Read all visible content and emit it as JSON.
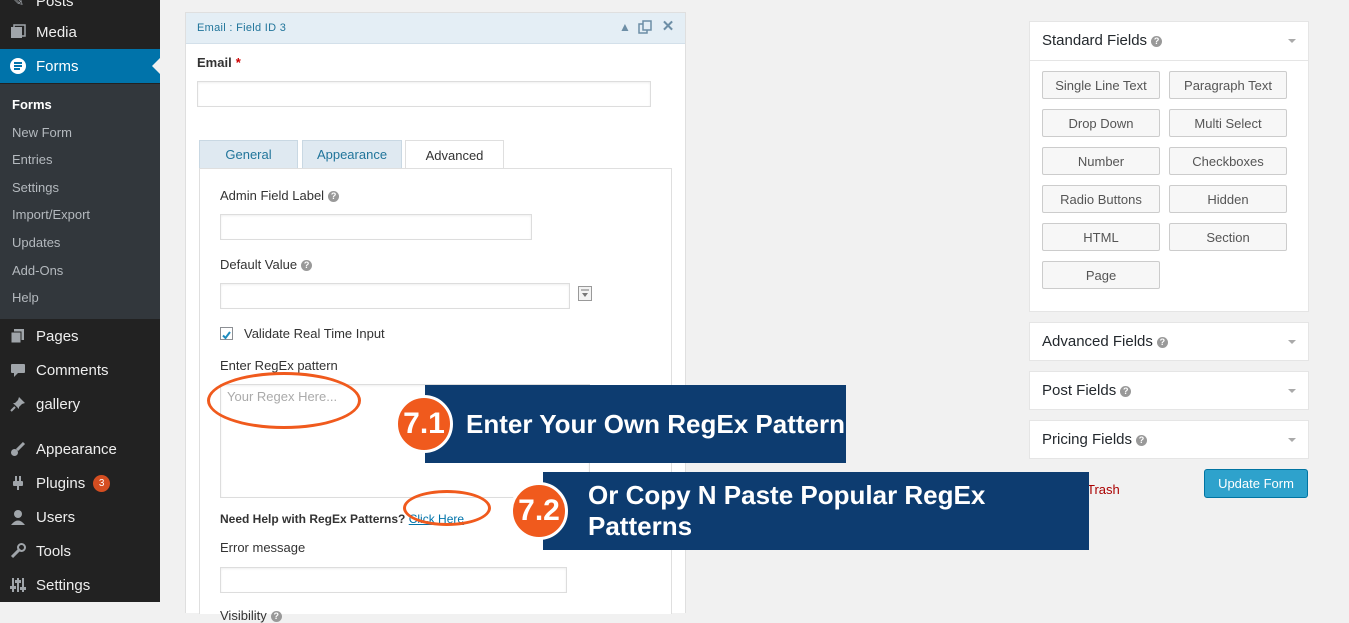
{
  "sidebar": {
    "top_items": [
      {
        "label": "Posts",
        "icon": "pin-icon"
      },
      {
        "label": "Media",
        "icon": "media-icon"
      },
      {
        "label": "Forms",
        "icon": "forms-icon"
      }
    ],
    "submenu": [
      "Forms",
      "New Form",
      "Entries",
      "Settings",
      "Import/Export",
      "Updates",
      "Add-Ons",
      "Help"
    ],
    "bottom_items": [
      {
        "label": "Pages",
        "icon": "pages-icon"
      },
      {
        "label": "Comments",
        "icon": "comments-icon"
      },
      {
        "label": "gallery",
        "icon": "pin-icon"
      },
      {
        "label": "Appearance",
        "icon": "brush-icon"
      },
      {
        "label": "Plugins",
        "icon": "plug-icon",
        "badge": "3"
      },
      {
        "label": "Users",
        "icon": "user-icon"
      },
      {
        "label": "Tools",
        "icon": "wrench-icon"
      },
      {
        "label": "Settings",
        "icon": "sliders-icon"
      }
    ]
  },
  "field": {
    "header_title": "Email : Field ID 3",
    "label": "Email",
    "required_mark": "*",
    "tabs": [
      "General",
      "Appearance",
      "Advanced"
    ],
    "selected_tab": "Advanced",
    "admin_label": "Admin Field Label",
    "default_value_label": "Default Value",
    "validate_label": "Validate Real Time Input",
    "validate_checked": true,
    "regex_label": "Enter RegEx pattern",
    "regex_placeholder": "Your Regex Here...",
    "help_text": "Need Help with RegEx Patterns?",
    "help_link": "Click Here",
    "error_label": "Error message",
    "visibility_label": "Visibility"
  },
  "right": {
    "standard_title": "Standard Fields",
    "standard_buttons": [
      "Single Line Text",
      "Paragraph Text",
      "Drop Down",
      "Multi Select",
      "Number",
      "Checkboxes",
      "Radio Buttons",
      "Hidden",
      "HTML",
      "Section",
      "Page"
    ],
    "advanced_title": "Advanced Fields",
    "post_title": "Post Fields",
    "pricing_title": "Pricing Fields",
    "trash": "Trash",
    "update_button": "Update Form"
  },
  "callouts": [
    {
      "number": "7.1",
      "text": "Enter Your Own RegEx Pattern"
    },
    {
      "number": "7.2",
      "text": "Or Copy N Paste Popular RegEx Patterns"
    }
  ],
  "colors": {
    "accent": "#0073aa",
    "banner": "#0d3c70",
    "callout": "#f05a1d",
    "button": "#2ea2cc"
  }
}
